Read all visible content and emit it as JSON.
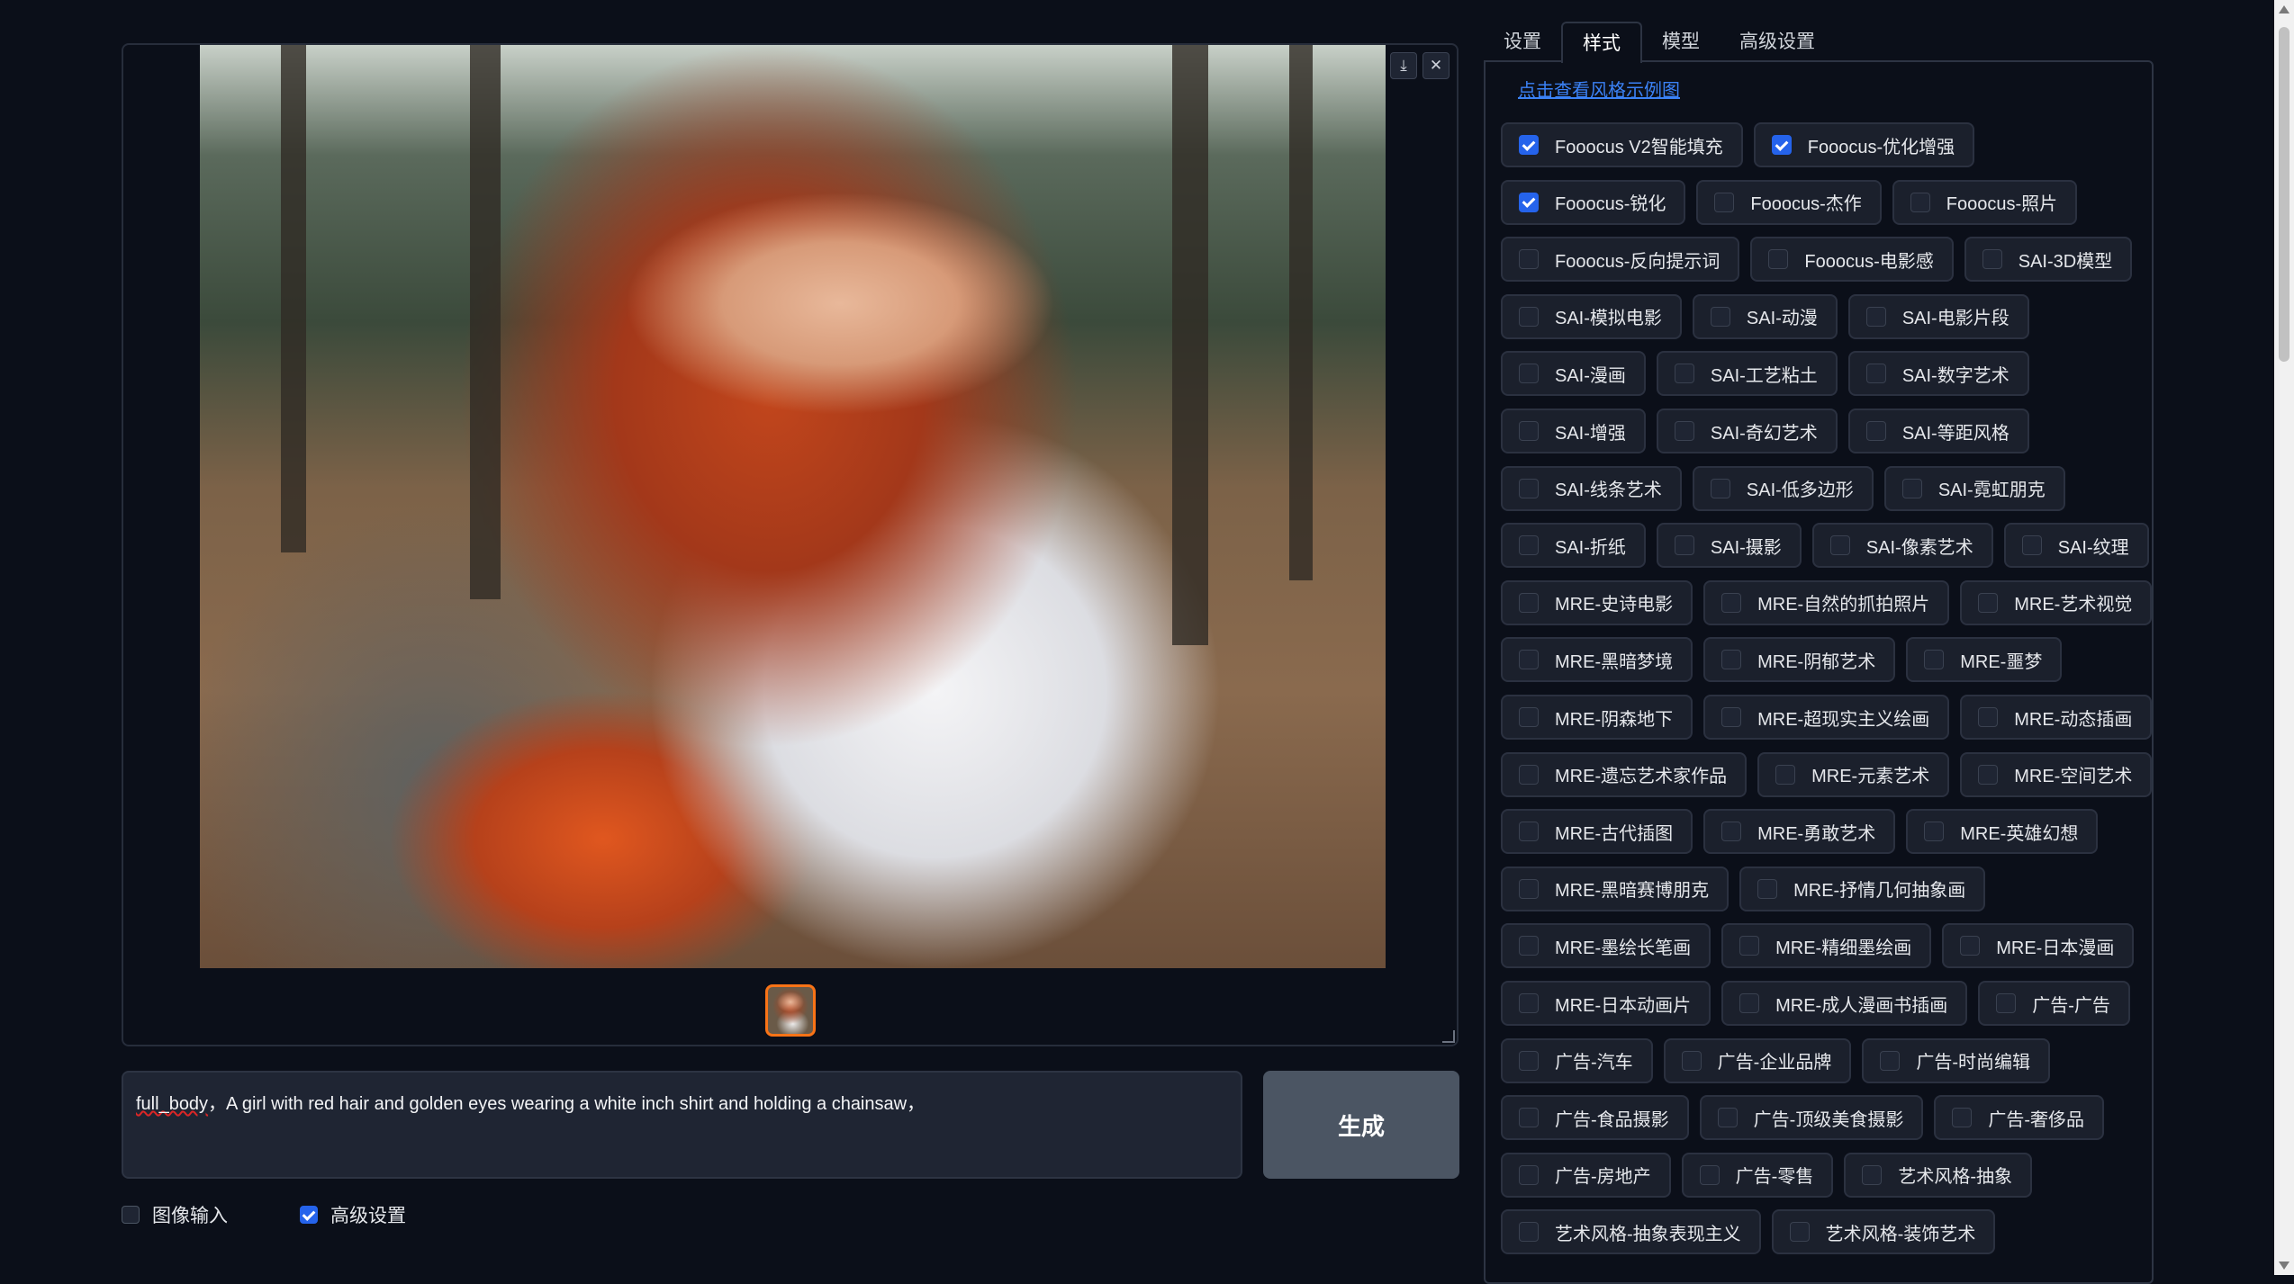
{
  "tabs": [
    {
      "label": "设置",
      "active": false
    },
    {
      "label": "样式",
      "active": true
    },
    {
      "label": "模型",
      "active": false
    },
    {
      "label": "高级设置",
      "active": false
    }
  ],
  "style_link": "点击查看风格示例图",
  "style_rows": [
    [
      {
        "label": "Fooocus V2智能填充",
        "checked": true
      },
      {
        "label": "Fooocus-优化增强",
        "checked": true
      }
    ],
    [
      {
        "label": "Fooocus-锐化",
        "checked": true
      },
      {
        "label": "Fooocus-杰作",
        "checked": false
      },
      {
        "label": "Fooocus-照片",
        "checked": false
      }
    ],
    [
      {
        "label": "Fooocus-反向提示词",
        "checked": false
      },
      {
        "label": "Fooocus-电影感",
        "checked": false
      },
      {
        "label": "SAI-3D模型",
        "checked": false
      }
    ],
    [
      {
        "label": "SAI-模拟电影",
        "checked": false
      },
      {
        "label": "SAI-动漫",
        "checked": false
      },
      {
        "label": "SAI-电影片段",
        "checked": false
      }
    ],
    [
      {
        "label": "SAI-漫画",
        "checked": false
      },
      {
        "label": "SAI-工艺粘土",
        "checked": false
      },
      {
        "label": "SAI-数字艺术",
        "checked": false
      }
    ],
    [
      {
        "label": "SAI-增强",
        "checked": false
      },
      {
        "label": "SAI-奇幻艺术",
        "checked": false
      },
      {
        "label": "SAI-等距风格",
        "checked": false
      }
    ],
    [
      {
        "label": "SAI-线条艺术",
        "checked": false
      },
      {
        "label": "SAI-低多边形",
        "checked": false
      },
      {
        "label": "SAI-霓虹朋克",
        "checked": false
      }
    ],
    [
      {
        "label": "SAI-折纸",
        "checked": false
      },
      {
        "label": "SAI-摄影",
        "checked": false
      },
      {
        "label": "SAI-像素艺术",
        "checked": false
      },
      {
        "label": "SAI-纹理",
        "checked": false
      }
    ],
    [
      {
        "label": "MRE-史诗电影",
        "checked": false
      },
      {
        "label": "MRE-自然的抓拍照片",
        "checked": false
      },
      {
        "label": "MRE-艺术视觉",
        "checked": false
      }
    ],
    [
      {
        "label": "MRE-黑暗梦境",
        "checked": false
      },
      {
        "label": "MRE-阴郁艺术",
        "checked": false
      },
      {
        "label": "MRE-噩梦",
        "checked": false
      }
    ],
    [
      {
        "label": "MRE-阴森地下",
        "checked": false
      },
      {
        "label": "MRE-超现实主义绘画",
        "checked": false
      },
      {
        "label": "MRE-动态插画",
        "checked": false
      }
    ],
    [
      {
        "label": "MRE-遗忘艺术家作品",
        "checked": false
      },
      {
        "label": "MRE-元素艺术",
        "checked": false
      },
      {
        "label": "MRE-空间艺术",
        "checked": false
      }
    ],
    [
      {
        "label": "MRE-古代插图",
        "checked": false
      },
      {
        "label": "MRE-勇敢艺术",
        "checked": false
      },
      {
        "label": "MRE-英雄幻想",
        "checked": false
      }
    ],
    [
      {
        "label": "MRE-黑暗赛博朋克",
        "checked": false
      },
      {
        "label": "MRE-抒情几何抽象画",
        "checked": false
      }
    ],
    [
      {
        "label": "MRE-墨绘长笔画",
        "checked": false
      },
      {
        "label": "MRE-精细墨绘画",
        "checked": false
      },
      {
        "label": "MRE-日本漫画",
        "checked": false
      }
    ],
    [
      {
        "label": "MRE-日本动画片",
        "checked": false
      },
      {
        "label": "MRE-成人漫画书插画",
        "checked": false
      },
      {
        "label": "广告-广告",
        "checked": false
      }
    ],
    [
      {
        "label": "广告-汽车",
        "checked": false
      },
      {
        "label": "广告-企业品牌",
        "checked": false
      },
      {
        "label": "广告-时尚编辑",
        "checked": false
      }
    ],
    [
      {
        "label": "广告-食品摄影",
        "checked": false
      },
      {
        "label": "广告-顶级美食摄影",
        "checked": false
      },
      {
        "label": "广告-奢侈品",
        "checked": false
      }
    ],
    [
      {
        "label": "广告-房地产",
        "checked": false
      },
      {
        "label": "广告-零售",
        "checked": false
      },
      {
        "label": "艺术风格-抽象",
        "checked": false
      }
    ],
    [
      {
        "label": "艺术风格-抽象表现主义",
        "checked": false
      },
      {
        "label": "艺术风格-装饰艺术",
        "checked": false
      }
    ]
  ],
  "prompt": {
    "spell_word": "full_body",
    "rest": "，A girl with red hair and golden eyes wearing a white inch shirt and holding a chainsaw，"
  },
  "generate_label": "生成",
  "image_input": {
    "label": "图像输入",
    "checked": false
  },
  "advanced": {
    "label": "高级设置",
    "checked": true
  },
  "icons": {
    "download": "download-icon",
    "close": "close-icon"
  },
  "colors": {
    "background": "#0b0f19",
    "accent": "#2563eb",
    "thumb_border": "#f97316",
    "link": "#3b82f6"
  }
}
